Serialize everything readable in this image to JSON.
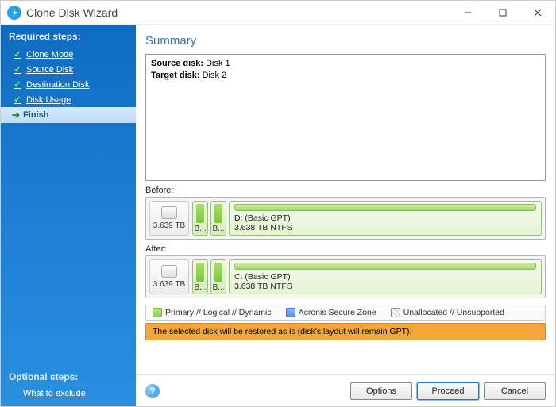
{
  "window": {
    "title": "Clone Disk Wizard"
  },
  "sidebar": {
    "required_header": "Required steps:",
    "optional_header": "Optional steps:",
    "steps": [
      {
        "label": "Clone Mode"
      },
      {
        "label": "Source Disk"
      },
      {
        "label": "Destination Disk"
      },
      {
        "label": "Disk Usage"
      },
      {
        "label": "Finish"
      }
    ],
    "optional_link": "What to exclude"
  },
  "main": {
    "title": "Summary",
    "source_label": "Source disk:",
    "source_value": "Disk 1",
    "target_label": "Target disk:",
    "target_value": "Disk 2",
    "before_label": "Before:",
    "after_label": "After:",
    "before": {
      "total": "3.639 TB",
      "small1": "B...",
      "small2": "B...",
      "big_label": "D: (Basic GPT)",
      "big_size": "3.638 TB  NTFS"
    },
    "after": {
      "total": "3.639 TB",
      "small1": "B...",
      "small2": "B...",
      "big_label": "C: (Basic GPT)",
      "big_size": "3.638 TB  NTFS"
    },
    "legend": {
      "primary": "Primary // Logical // Dynamic",
      "secure": "Acronis Secure Zone",
      "unalloc": "Unallocated // Unsupported"
    },
    "warning": "The selected disk will be restored as is (disk's layout will remain GPT)."
  },
  "footer": {
    "options": "Options",
    "proceed": "Proceed",
    "cancel": "Cancel"
  }
}
